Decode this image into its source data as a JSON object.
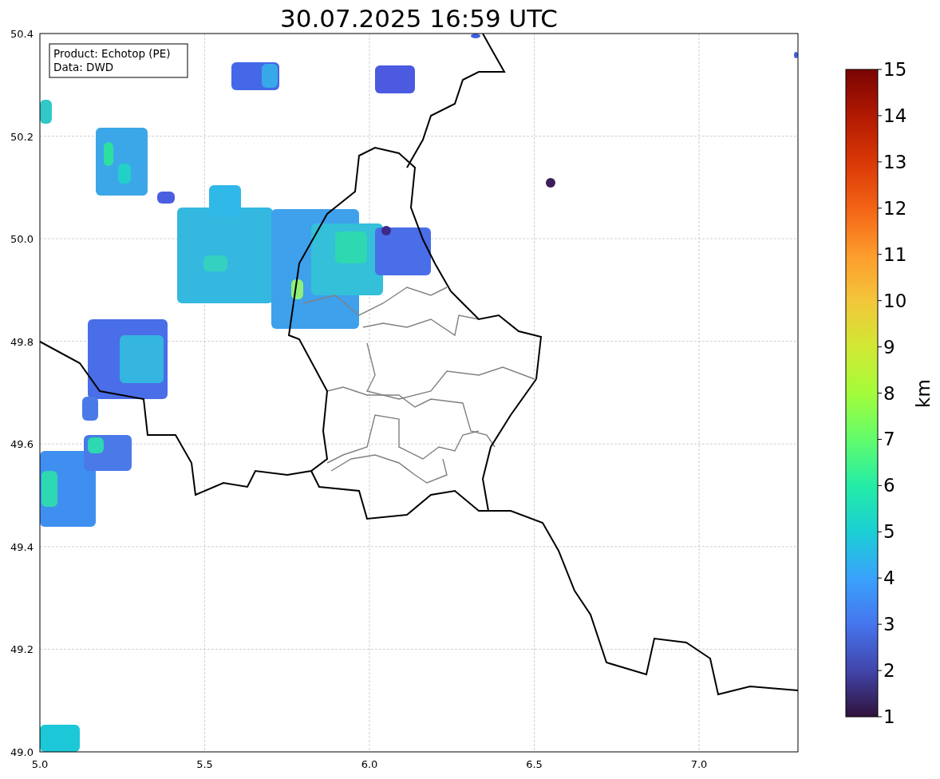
{
  "title": "30.07.2025 16:59 UTC",
  "info_box": [
    "Product: Echotop (PE)",
    "Data: DWD"
  ],
  "map": {
    "x_ticks": [
      "5.0",
      "5.5",
      "6.0",
      "6.5",
      "7.0"
    ],
    "y_ticks": [
      "50.4",
      "50.2",
      "50.0",
      "49.8",
      "49.6",
      "49.4",
      "49.2",
      "49.0"
    ]
  },
  "colorbar": {
    "label": "km",
    "ticks": [
      "15",
      "14",
      "13",
      "12",
      "11",
      "10",
      "9",
      "8",
      "7",
      "6",
      "5",
      "4",
      "3",
      "2",
      "1"
    ]
  }
}
